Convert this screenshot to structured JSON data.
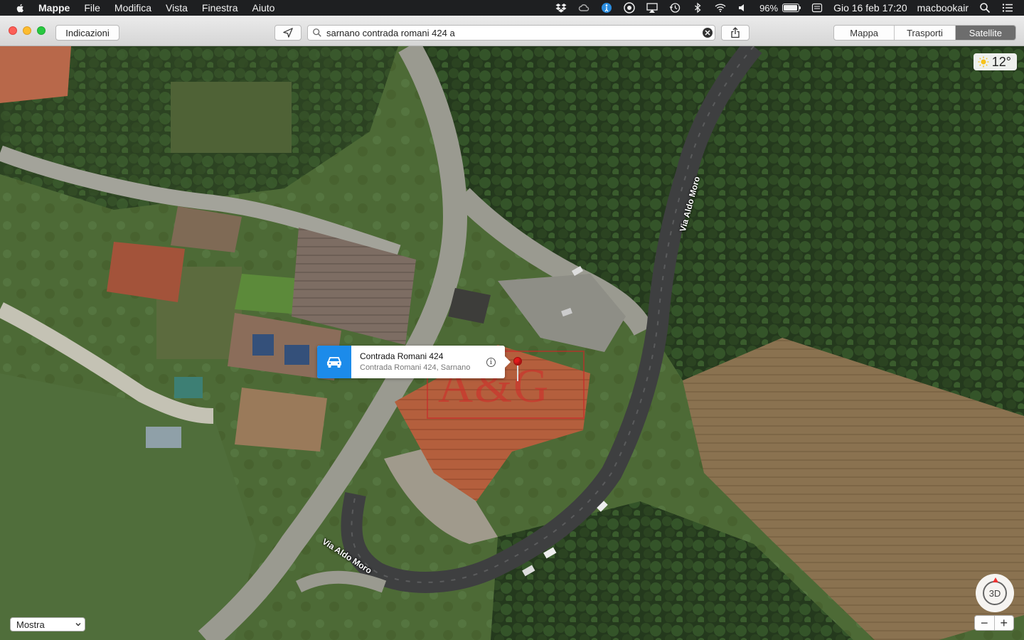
{
  "menubar": {
    "apple_icon": "apple-icon",
    "app_name": "Mappe",
    "items": [
      "File",
      "Modifica",
      "Vista",
      "Finestra",
      "Aiuto"
    ],
    "battery_percent": "96%",
    "battery_level": 0.96,
    "clock": "Gio 16 feb  17:20",
    "user": "macbookair"
  },
  "toolbar": {
    "directions_label": "Indicazioni",
    "search_value": "sarnano contrada romani 424 a",
    "segments": [
      "Mappa",
      "Trasporti",
      "Satellite"
    ],
    "active_segment": "Satellite"
  },
  "map": {
    "weather_temp": "12°",
    "road_labels": [
      "Via Aldo Moro",
      "Via Aldo Moro"
    ],
    "callout": {
      "title": "Contrada Romani 424",
      "subtitle": "Contrada Romani 424, Sarnano"
    },
    "watermark": "A&G",
    "compass_label": "3D",
    "zoom_out": "−",
    "zoom_in": "+",
    "show_select": "Mostra"
  },
  "colors": {
    "accent_blue": "#1c8bea",
    "pin_red": "#e21b1b",
    "active_segment_bg": "#6d6d6d"
  }
}
